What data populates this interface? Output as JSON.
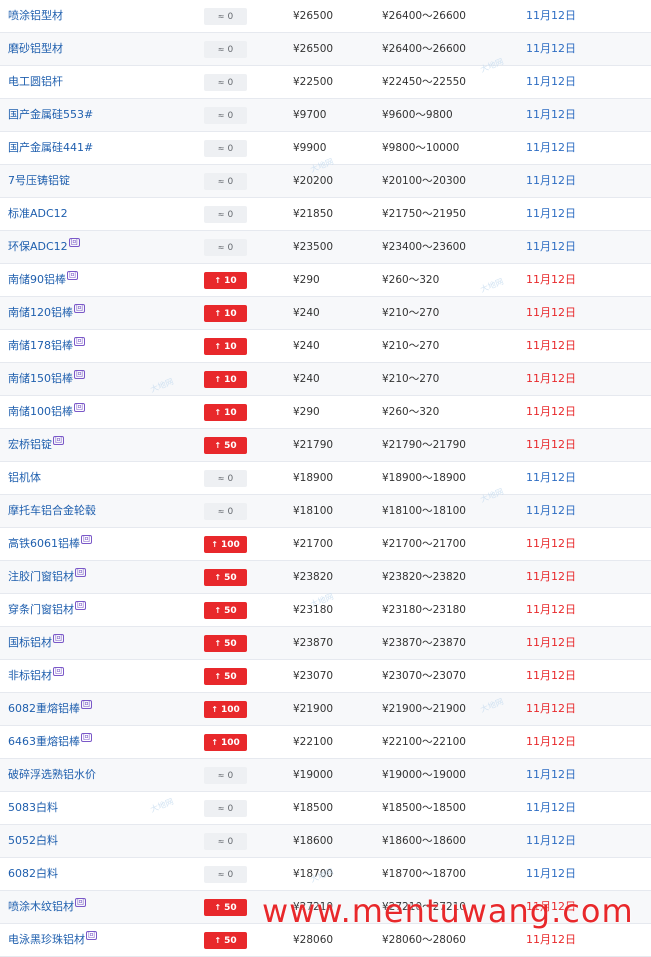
{
  "rows": [
    {
      "name": "喷涂铝型材",
      "sup": "",
      "dir": "flat",
      "change": "0",
      "price": "¥26500",
      "range": "¥26400～26600",
      "date": "11月12日"
    },
    {
      "name": "磨砂铝型材",
      "sup": "",
      "dir": "flat",
      "change": "0",
      "price": "¥26500",
      "range": "¥26400～26600",
      "date": "11月12日"
    },
    {
      "name": "电工圆铝杆",
      "sup": "",
      "dir": "flat",
      "change": "0",
      "price": "¥22500",
      "range": "¥22450～22550",
      "date": "11月12日"
    },
    {
      "name": "国产金属硅553#",
      "sup": "",
      "dir": "flat",
      "change": "0",
      "price": "¥9700",
      "range": "¥9600～9800",
      "date": "11月12日"
    },
    {
      "name": "国产金属硅441#",
      "sup": "",
      "dir": "flat",
      "change": "0",
      "price": "¥9900",
      "range": "¥9800～10000",
      "date": "11月12日"
    },
    {
      "name": "7号压铸铝锭",
      "sup": "",
      "dir": "flat",
      "change": "0",
      "price": "¥20200",
      "range": "¥20100～20300",
      "date": "11月12日"
    },
    {
      "name": "标准ADC12",
      "sup": "",
      "dir": "flat",
      "change": "0",
      "price": "¥21850",
      "range": "¥21750～21950",
      "date": "11月12日"
    },
    {
      "name": "环保ADC12",
      "sup": "回",
      "dir": "flat",
      "change": "0",
      "price": "¥23500",
      "range": "¥23400～23600",
      "date": "11月12日"
    },
    {
      "name": "南储90铝棒",
      "sup": "回",
      "dir": "up",
      "change": "10",
      "price": "¥290",
      "range": "¥260～320",
      "date": "11月12日"
    },
    {
      "name": "南储120铝棒",
      "sup": "回",
      "dir": "up",
      "change": "10",
      "price": "¥240",
      "range": "¥210～270",
      "date": "11月12日"
    },
    {
      "name": "南储178铝棒",
      "sup": "回",
      "dir": "up",
      "change": "10",
      "price": "¥240",
      "range": "¥210～270",
      "date": "11月12日"
    },
    {
      "name": "南储150铝棒",
      "sup": "回",
      "dir": "up",
      "change": "10",
      "price": "¥240",
      "range": "¥210～270",
      "date": "11月12日"
    },
    {
      "name": "南储100铝棒",
      "sup": "回",
      "dir": "up",
      "change": "10",
      "price": "¥290",
      "range": "¥260～320",
      "date": "11月12日"
    },
    {
      "name": "宏桥铝锭",
      "sup": "回",
      "dir": "up",
      "change": "50",
      "price": "¥21790",
      "range": "¥21790～21790",
      "date": "11月12日"
    },
    {
      "name": "铝机体",
      "sup": "",
      "dir": "flat",
      "change": "0",
      "price": "¥18900",
      "range": "¥18900～18900",
      "date": "11月12日"
    },
    {
      "name": "摩托车铝合金轮毂",
      "sup": "",
      "dir": "flat",
      "change": "0",
      "price": "¥18100",
      "range": "¥18100～18100",
      "date": "11月12日"
    },
    {
      "name": "高铁6061铝棒",
      "sup": "回",
      "dir": "up",
      "change": "100",
      "price": "¥21700",
      "range": "¥21700～21700",
      "date": "11月12日"
    },
    {
      "name": "注胶门窗铝材",
      "sup": "回",
      "dir": "up",
      "change": "50",
      "price": "¥23820",
      "range": "¥23820～23820",
      "date": "11月12日"
    },
    {
      "name": "穿条门窗铝材",
      "sup": "回",
      "dir": "up",
      "change": "50",
      "price": "¥23180",
      "range": "¥23180～23180",
      "date": "11月12日"
    },
    {
      "name": "国标铝材",
      "sup": "回",
      "dir": "up",
      "change": "50",
      "price": "¥23870",
      "range": "¥23870～23870",
      "date": "11月12日"
    },
    {
      "name": "非标铝材",
      "sup": "回",
      "dir": "up",
      "change": "50",
      "price": "¥23070",
      "range": "¥23070～23070",
      "date": "11月12日"
    },
    {
      "name": "6082重熔铝棒",
      "sup": "回",
      "dir": "up",
      "change": "100",
      "price": "¥21900",
      "range": "¥21900～21900",
      "date": "11月12日"
    },
    {
      "name": "6463重熔铝棒",
      "sup": "回",
      "dir": "up",
      "change": "100",
      "price": "¥22100",
      "range": "¥22100～22100",
      "date": "11月12日"
    },
    {
      "name": "破碎浮选熟铝水价",
      "sup": "",
      "dir": "flat",
      "change": "0",
      "price": "¥19000",
      "range": "¥19000～19000",
      "date": "11月12日"
    },
    {
      "name": "5083白料",
      "sup": "",
      "dir": "flat",
      "change": "0",
      "price": "¥18500",
      "range": "¥18500～18500",
      "date": "11月12日"
    },
    {
      "name": "5052白料",
      "sup": "",
      "dir": "flat",
      "change": "0",
      "price": "¥18600",
      "range": "¥18600～18600",
      "date": "11月12日"
    },
    {
      "name": "6082白料",
      "sup": "",
      "dir": "flat",
      "change": "0",
      "price": "¥18700",
      "range": "¥18700～18700",
      "date": "11月12日"
    },
    {
      "name": "喷涂木纹铝材",
      "sup": "回",
      "dir": "up",
      "change": "50",
      "price": "¥27210",
      "range": "¥27210～27210",
      "date": "11月12日"
    },
    {
      "name": "电泳黑珍珠铝材",
      "sup": "回",
      "dir": "up",
      "change": "50",
      "price": "¥28060",
      "range": "¥28060～28060",
      "date": "11月12日"
    }
  ],
  "icons": {
    "flat": "≈",
    "up": "↑"
  },
  "colors": {
    "up": "#e8282b",
    "flat_bg": "#eef0f3",
    "link": "#1f5fae",
    "date_blue": "#2e6dc2"
  },
  "watermark_text": "大地网",
  "site_watermark": "www.mentuwang.com"
}
